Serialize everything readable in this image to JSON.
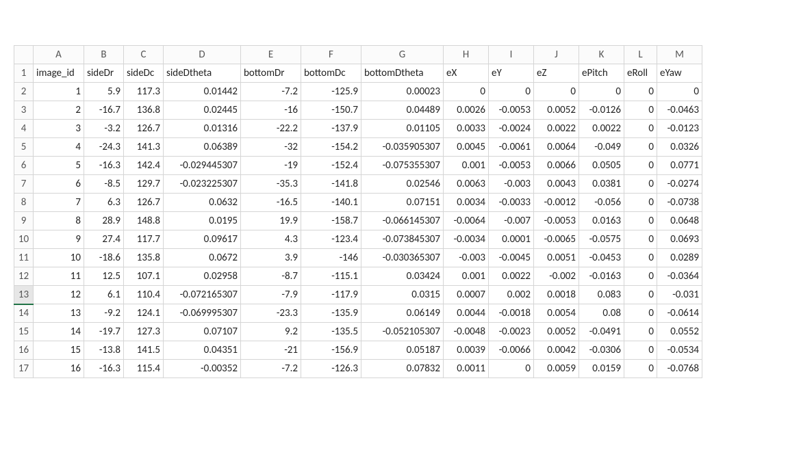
{
  "selected_row_header_index": 12,
  "col_letters": [
    "A",
    "B",
    "C",
    "D",
    "E",
    "F",
    "G",
    "H",
    "I",
    "J",
    "K",
    "L",
    "M"
  ],
  "col_classes": [
    "c-A",
    "c-B",
    "c-C",
    "c-D",
    "c-E",
    "c-F",
    "c-G",
    "c-H",
    "c-I",
    "c-J",
    "c-K",
    "c-L",
    "c-M"
  ],
  "row_numbers": [
    1,
    2,
    3,
    4,
    5,
    6,
    7,
    8,
    9,
    10,
    11,
    12,
    13,
    14,
    15,
    16,
    17
  ],
  "header_row": [
    "image_id",
    "sideDr",
    "sideDc",
    "sideDtheta",
    "bottomDr",
    "bottomDc",
    "bottomDtheta",
    "eX",
    "eY",
    "eZ",
    "ePitch",
    "eRoll",
    "eYaw"
  ],
  "data_rows": [
    [
      1,
      5.9,
      117.3,
      "0.01442",
      -7.2,
      -125.9,
      "0.00023",
      0,
      0,
      0,
      0,
      0,
      0
    ],
    [
      2,
      -16.7,
      136.8,
      "0.02445",
      -16,
      -150.7,
      "0.04489",
      "0.0026",
      "-0.0053",
      "0.0052",
      "-0.0126",
      0,
      "-0.0463"
    ],
    [
      3,
      -3.2,
      126.7,
      "0.01316",
      -22.2,
      -137.9,
      "0.01105",
      "0.0033",
      "-0.0024",
      "0.0022",
      "0.0022",
      0,
      "-0.0123"
    ],
    [
      4,
      -24.3,
      141.3,
      "0.06389",
      -32,
      -154.2,
      "-0.035905307",
      "0.0045",
      "-0.0061",
      "0.0064",
      "-0.049",
      0,
      "0.0326"
    ],
    [
      5,
      -16.3,
      142.4,
      "-0.029445307",
      -19,
      -152.4,
      "-0.075355307",
      "0.001",
      "-0.0053",
      "0.0066",
      "0.0505",
      0,
      "0.0771"
    ],
    [
      6,
      -8.5,
      129.7,
      "-0.023225307",
      -35.3,
      -141.8,
      "0.02546",
      "0.0063",
      "-0.003",
      "0.0043",
      "0.0381",
      0,
      "-0.0274"
    ],
    [
      7,
      6.3,
      126.7,
      "0.0632",
      -16.5,
      -140.1,
      "0.07151",
      "0.0034",
      "-0.0033",
      "-0.0012",
      "-0.056",
      0,
      "-0.0738"
    ],
    [
      8,
      28.9,
      148.8,
      "0.0195",
      19.9,
      -158.7,
      "-0.066145307",
      "-0.0064",
      "-0.007",
      "-0.0053",
      "0.0163",
      0,
      "0.0648"
    ],
    [
      9,
      27.4,
      117.7,
      "0.09617",
      4.3,
      -123.4,
      "-0.073845307",
      "-0.0034",
      "0.0001",
      "-0.0065",
      "-0.0575",
      0,
      "0.0693"
    ],
    [
      10,
      -18.6,
      135.8,
      "0.0672",
      3.9,
      -146,
      "-0.030365307",
      "-0.003",
      "-0.0045",
      "0.0051",
      "-0.0453",
      0,
      "0.0289"
    ],
    [
      11,
      12.5,
      107.1,
      "0.02958",
      -8.7,
      -115.1,
      "0.03424",
      "0.001",
      "0.0022",
      "-0.002",
      "-0.0163",
      0,
      "-0.0364"
    ],
    [
      12,
      6.1,
      110.4,
      "-0.072165307",
      -7.9,
      -117.9,
      "0.0315",
      "0.0007",
      "0.002",
      "0.0018",
      "0.083",
      0,
      "-0.031"
    ],
    [
      13,
      -9.2,
      124.1,
      "-0.069995307",
      -23.3,
      -135.9,
      "0.06149",
      "0.0044",
      "-0.0018",
      "0.0054",
      "0.08",
      0,
      "-0.0614"
    ],
    [
      14,
      -19.7,
      127.3,
      "0.07107",
      9.2,
      -135.5,
      "-0.052105307",
      "-0.0048",
      "-0.0023",
      "0.0052",
      "-0.0491",
      0,
      "0.0552"
    ],
    [
      15,
      -13.8,
      141.5,
      "0.04351",
      -21,
      -156.9,
      "0.05187",
      "0.0039",
      "-0.0066",
      "0.0042",
      "-0.0306",
      0,
      "-0.0534"
    ],
    [
      16,
      -16.3,
      115.4,
      "-0.00352",
      -7.2,
      -126.3,
      "0.07832",
      "0.0011",
      0,
      "0.0059",
      "0.0159",
      0,
      "-0.0768"
    ]
  ]
}
